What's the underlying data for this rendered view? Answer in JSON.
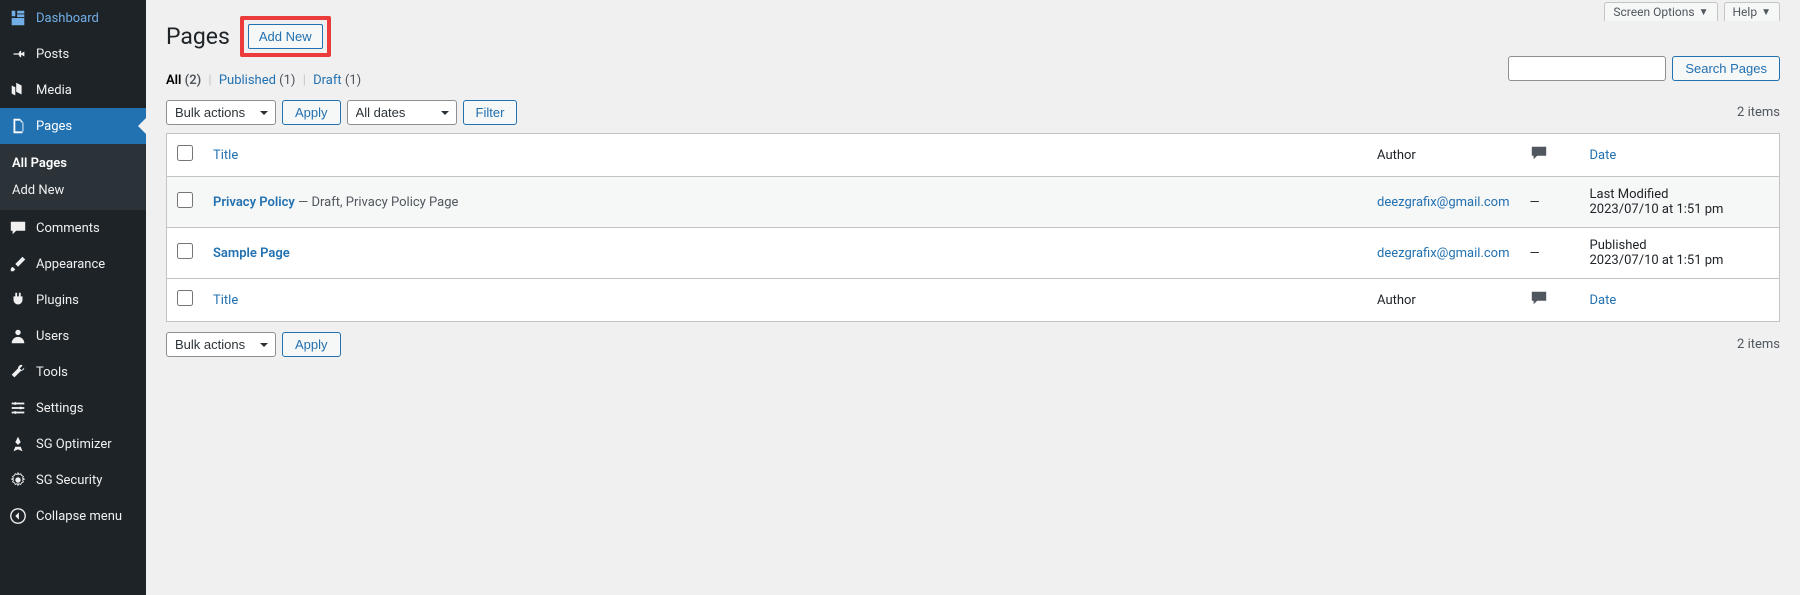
{
  "sidebar": {
    "items": [
      {
        "label": "Dashboard"
      },
      {
        "label": "Posts"
      },
      {
        "label": "Media"
      },
      {
        "label": "Pages"
      },
      {
        "label": "Comments"
      },
      {
        "label": "Appearance"
      },
      {
        "label": "Plugins"
      },
      {
        "label": "Users"
      },
      {
        "label": "Tools"
      },
      {
        "label": "Settings"
      },
      {
        "label": "SG Optimizer"
      },
      {
        "label": "SG Security"
      },
      {
        "label": "Collapse menu"
      }
    ],
    "sub": [
      {
        "label": "All Pages"
      },
      {
        "label": "Add New"
      }
    ]
  },
  "top_tabs": {
    "screen_options": "Screen Options",
    "help": "Help"
  },
  "header": {
    "title": "Pages",
    "add_new": "Add New"
  },
  "status_filters": {
    "all_label": "All",
    "all_count": "(2)",
    "published_label": "Published",
    "published_count": "(1)",
    "draft_label": "Draft",
    "draft_count": "(1)"
  },
  "search": {
    "button": "Search Pages",
    "value": ""
  },
  "controls": {
    "bulk": "Bulk actions",
    "apply": "Apply",
    "dates": "All dates",
    "filter": "Filter",
    "items_count": "2 items"
  },
  "table": {
    "head": {
      "title": "Title",
      "author": "Author",
      "date": "Date"
    },
    "rows": [
      {
        "title": "Privacy Policy",
        "suffix": " — Draft, Privacy Policy Page",
        "author": "deezgrafix@gmail.com",
        "comments": "—",
        "date_status": "Last Modified",
        "date_value": "2023/07/10 at 1:51 pm"
      },
      {
        "title": "Sample Page",
        "suffix": "",
        "author": "deezgrafix@gmail.com",
        "comments": "—",
        "date_status": "Published",
        "date_value": "2023/07/10 at 1:51 pm"
      }
    ]
  }
}
